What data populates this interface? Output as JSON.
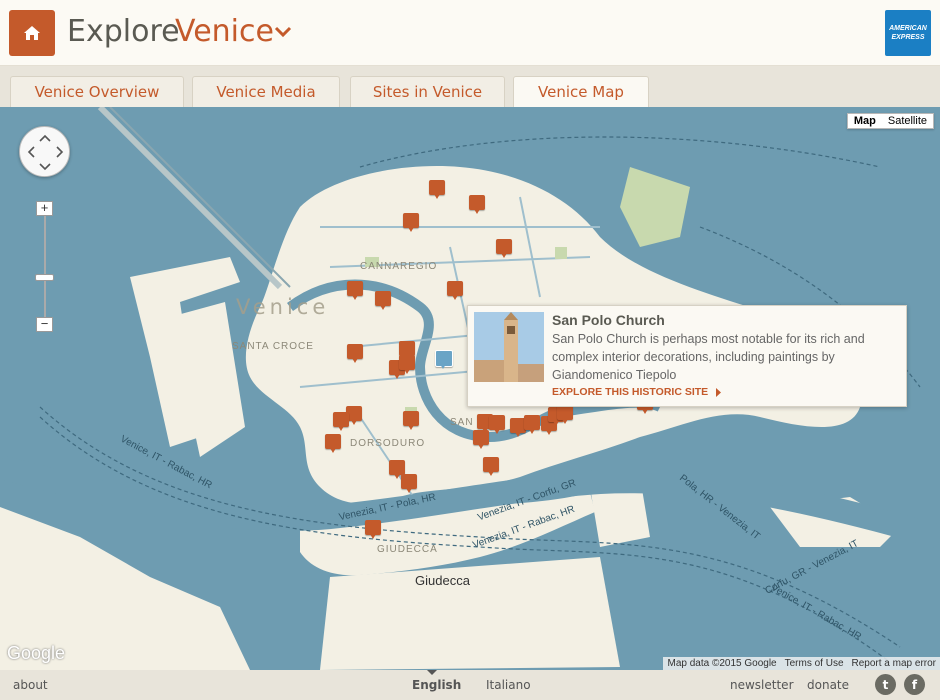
{
  "header": {
    "explore": "Explore",
    "city": "Venice",
    "brand": "AMERICAN EXPRESS"
  },
  "tabs": [
    {
      "label": "Venice Overview"
    },
    {
      "label": "Venice Media"
    },
    {
      "label": "Sites in Venice"
    },
    {
      "label": "Venice Map",
      "active": true
    }
  ],
  "map": {
    "type_map": "Map",
    "type_satellite": "Satellite",
    "zoom_in": "+",
    "zoom_out": "−",
    "city_label": "Venice",
    "districts": {
      "cannaregio": "CANNAREGIO",
      "santa_croce": "SANTA CROCE",
      "dorsoduro": "DORSODURO",
      "giudecca_upper": "GIUDECCA",
      "san": "SAN"
    },
    "island_label": "Giudecca",
    "water_labels": {
      "a": "Venice, IT - Rabac, HR",
      "b": "Venezia, IT - Pola, HR",
      "c": "Venezia, IT - Corfu, GR",
      "d": "Venezia, IT - Rabac, HR",
      "e": "Pola, HR - Venezia, IT",
      "f": "Corfu, GR - Venezia, IT",
      "g": "Venice, IT - Rabac, HR"
    },
    "google": "Google",
    "attribution": {
      "data": "Map data ©2015 Google",
      "terms": "Terms of Use",
      "report": "Report a map error"
    },
    "popup": {
      "title": "San Polo Church",
      "description": "San Polo Church is perhaps most notable for its rich and complex interior decorations, including paintings by Giandomenico Tiepolo",
      "link": "EXPLORE THIS HISTORIC SITE"
    }
  },
  "footer": {
    "about": "about",
    "english": "English",
    "italiano": "Italiano",
    "newsletter": "newsletter",
    "donate": "donate",
    "twitter": "t",
    "facebook": "f"
  },
  "colors": {
    "accent": "#c45a2b",
    "water": "#6e9cb1",
    "land": "#f3f0e4"
  }
}
